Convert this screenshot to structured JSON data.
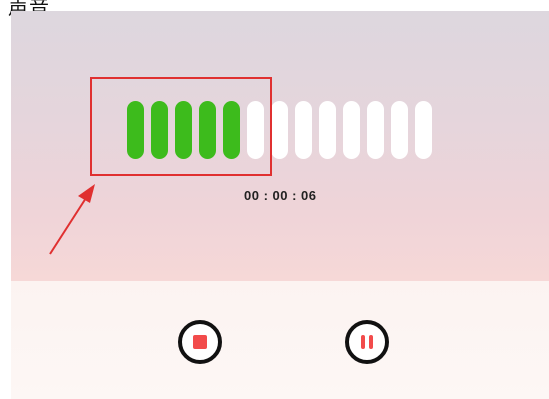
{
  "header": {
    "clipped_text": "声音"
  },
  "recorder": {
    "level_meter": {
      "total_bars": 13,
      "active_bars": 5,
      "active_color": "#3dbb1c",
      "inactive_color": "#ffffff"
    },
    "elapsed_time": "00 : 00 : 06"
  },
  "annotation": {
    "highlight_color": "#e03030"
  },
  "controls": {
    "stop_icon": "stop-icon",
    "pause_icon": "pause-icon",
    "icon_color": "#f24b4b"
  }
}
